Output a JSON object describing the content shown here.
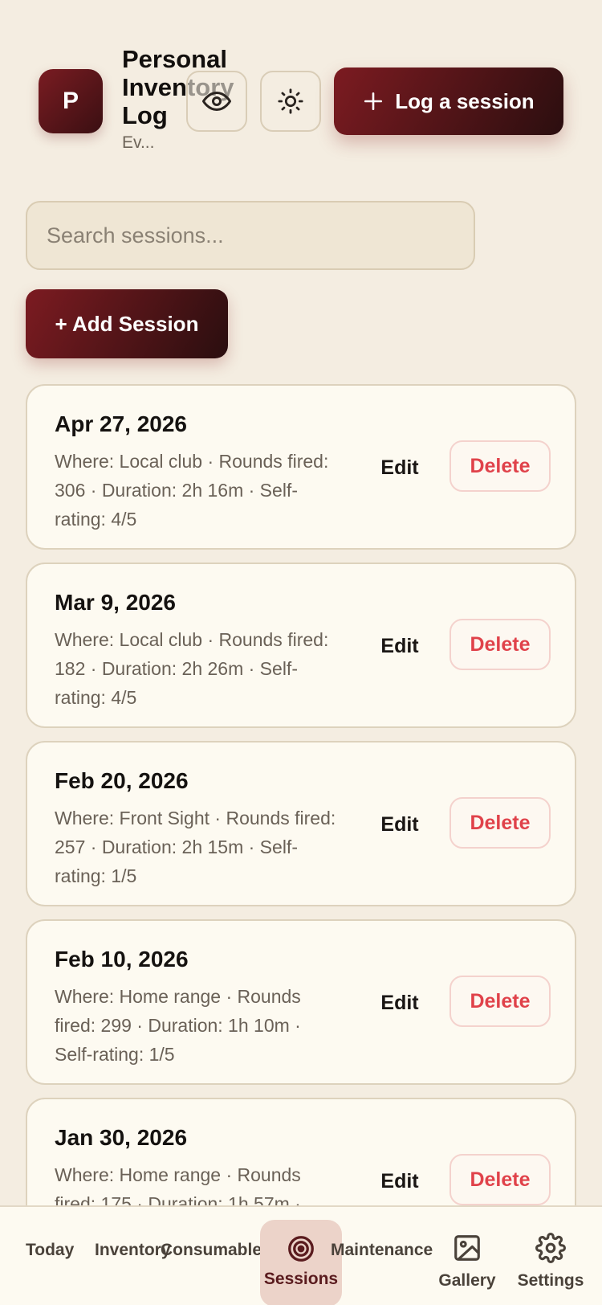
{
  "header": {
    "avatar_letter": "P",
    "title": "Personal Inventory Log",
    "subtitle": "Ev...",
    "log_button_label": "Log a session",
    "icons": [
      "eye-icon",
      "sun-icon",
      "plus-icon"
    ]
  },
  "search": {
    "placeholder": "Search sessions..."
  },
  "add_button_label": "+ Add Session",
  "sessions": [
    {
      "date": "Apr 27, 2026",
      "meta": "Where: Local club · Rounds fired: 306 · Duration: 2h 16m · Self-rating: 4/5",
      "edit": "Edit",
      "delete": "Delete"
    },
    {
      "date": "Mar 9, 2026",
      "meta": "Where: Local club · Rounds fired: 182 · Duration: 2h 26m · Self-rating: 4/5",
      "edit": "Edit",
      "delete": "Delete"
    },
    {
      "date": "Feb 20, 2026",
      "meta": "Where: Front Sight · Rounds fired: 257 · Duration: 2h 15m · Self-rating: 1/5",
      "edit": "Edit",
      "delete": "Delete"
    },
    {
      "date": "Feb 10, 2026",
      "meta": "Where: Home range · Rounds fired: 299 · Duration: 1h 10m · Self-rating: 1/5",
      "edit": "Edit",
      "delete": "Delete"
    },
    {
      "date": "Jan 30, 2026",
      "meta": "Where: Home range · Rounds fired: 175 · Duration: 1h 57m ·",
      "edit": "Edit",
      "delete": "Delete"
    }
  ],
  "nav": {
    "today": "Today",
    "inventory": "Inventory",
    "consumables": "Consumables",
    "sessions": "Sessions",
    "maintenance": "Maintenance",
    "gallery": "Gallery",
    "settings": "Settings",
    "active": "sessions"
  },
  "colors": {
    "accent": "#7c1b21",
    "accent_dark": "#2a0e0f",
    "background": "#f4ede1",
    "card": "#fdfaf1",
    "danger": "#e0424a"
  }
}
